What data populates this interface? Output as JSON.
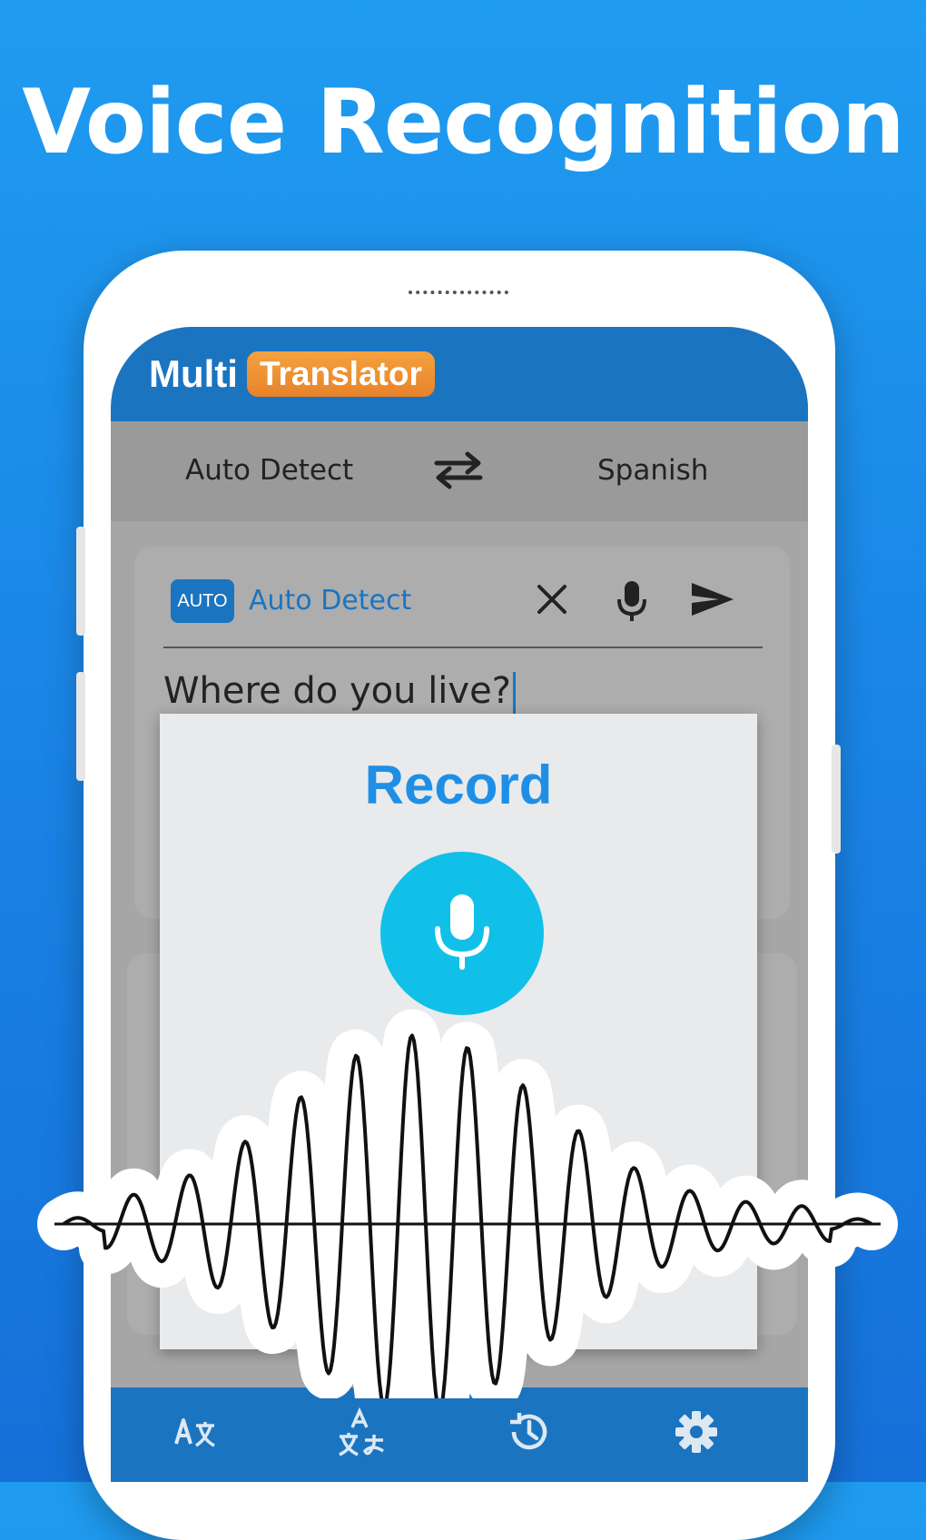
{
  "headline": "Voice Recognition",
  "app": {
    "logo_part1": "Multi",
    "logo_part2": "Translator"
  },
  "languages": {
    "source": "Auto Detect",
    "target": "Spanish"
  },
  "input_card": {
    "badge": "AUTO",
    "language": "Auto Detect",
    "text": "Where do you live?"
  },
  "dialog": {
    "title": "Record"
  },
  "colors": {
    "primary": "#1b74c0",
    "accent_orange": "#ea8a2e",
    "record_button": "#11c0e8",
    "dialog_title": "#1f8fe6"
  },
  "icons": {
    "swap": "swap-icon",
    "clear": "close-icon",
    "mic": "mic-icon",
    "send": "send-icon",
    "nav_translate": "translate-icon",
    "nav_language": "language-icon",
    "nav_history": "history-icon",
    "nav_settings": "gear-icon"
  }
}
